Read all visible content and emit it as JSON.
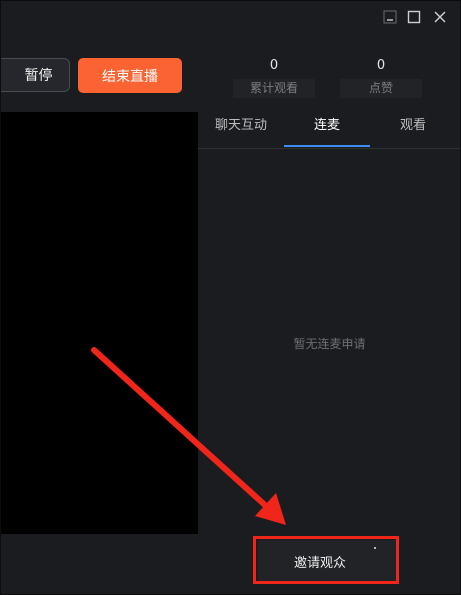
{
  "toolbar": {
    "pause_label": "暂停",
    "end_live_label": "结束直播"
  },
  "stats": {
    "total_views": {
      "value": "0",
      "label": "累计观看"
    },
    "likes": {
      "value": "0",
      "label": "点赞"
    }
  },
  "tabs": [
    {
      "label": "聊天互动",
      "active": false
    },
    {
      "label": "连麦",
      "active": true
    },
    {
      "label": "观看",
      "active": false
    }
  ],
  "panel": {
    "empty_message": "暂无连麦申请"
  },
  "invite": {
    "label": "邀请观众"
  },
  "colors": {
    "accent_orange": "#fb6333",
    "tab_underline_blue": "#3e8ef7",
    "annotation_red": "#f0261a"
  },
  "icons": {
    "minimize": "minimize-icon",
    "maximize": "maximize-icon",
    "close": "close-icon"
  }
}
